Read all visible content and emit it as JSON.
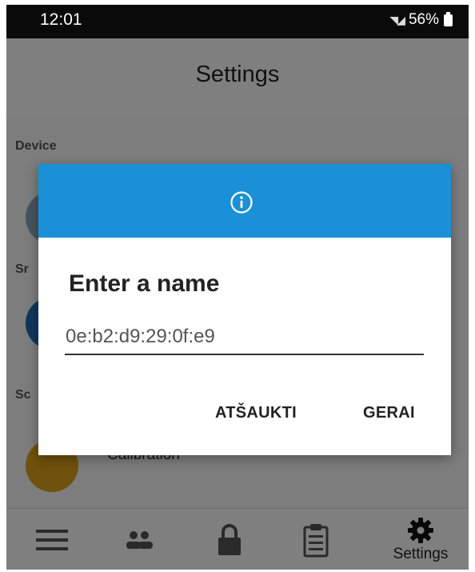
{
  "status_bar": {
    "time": "12:01",
    "battery": "56%"
  },
  "header": {
    "title": "Settings"
  },
  "content": {
    "section_device": "Device",
    "section_2": "Sr",
    "section_3": "Sc",
    "calibration_label": "Calibration"
  },
  "dialog": {
    "title": "Enter a name",
    "input_value": "0e:b2:d9:29:0f:e9",
    "cancel_label": "ATŠAUKTI",
    "ok_label": "GERAI"
  },
  "bottom_nav": {
    "settings_label": "Settings"
  },
  "colors": {
    "dialog_header": "#1a90d6",
    "calibration_avatar": "#e0a21a",
    "device_avatar": "#1e6fb8"
  }
}
